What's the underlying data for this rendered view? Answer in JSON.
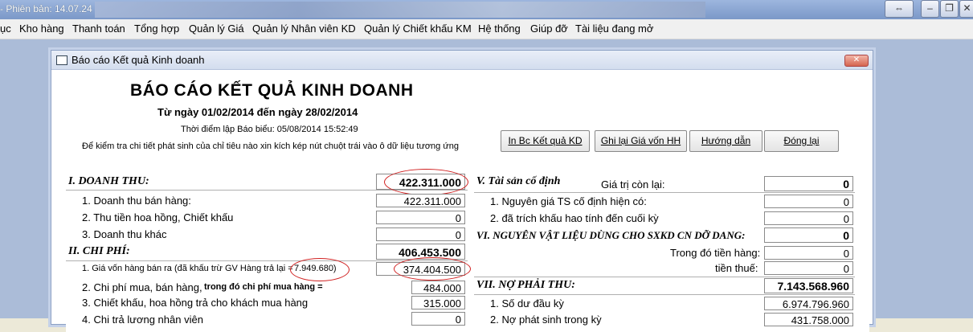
{
  "app": {
    "title_suffix": "- Phiên bản: 14.07.24",
    "ctrl_restore": "⇔",
    "ctrl_min": "–",
    "ctrl_max": "❐",
    "ctrl_close": "✕"
  },
  "menu": [
    "ục",
    "Kho hàng",
    "Thanh toán",
    "Tổng hợp",
    "Quản lý Giá",
    "Quản lý Nhân viên KD",
    "Quản lý Chiết khấu KM",
    "Hệ thống",
    "Giúp đỡ",
    "Tài liệu đang mở"
  ],
  "dialog": {
    "title": "Báo cáo Kết quả Kinh doanh",
    "close": "✕",
    "heading": "BÁO CÁO KẾT QUẢ KINH DOANH",
    "range": "Từ ngày 01/02/2014 đến ngày 28/02/2014",
    "time": "Thời điểm lập Báo biểu: 05/08/2014 15:52:49",
    "hint": "Để kiểm tra chi tiết phát sinh của chỉ tiêu nào xin kích kép nút chuột trái vào ô dữ liệu tương ứng",
    "buttons": {
      "print": "In Bc Kết quả KD",
      "save_cost": "Ghi lại Giá vốn HH",
      "guide": "Hướng dẫn",
      "close": "Đóng lại"
    }
  },
  "left": {
    "revenue": {
      "title": "I. DOANH THU:",
      "total": "422.311.000",
      "rows": [
        {
          "label": "1. Doanh thu bán hàng:",
          "value": "422.311.000"
        },
        {
          "label": "2. Thu tiền hoa hồng, Chiết khấu",
          "value": "0"
        },
        {
          "label": "3. Doanh thu khác",
          "value": "0"
        }
      ]
    },
    "expense": {
      "title": "II. CHI PHÍ:",
      "total": "406.453.500",
      "cogs_label": "1. Giá vốn hàng bán ra  (đã khấu trừ GV Hàng trả lại =",
      "cogs_return": "7.949.680)",
      "cogs_value": "374.404.500",
      "purchase_label": "2. Chi phí mua, bán hàng,",
      "purchase_note": "trong đó chi phí mua hàng =",
      "purchase_value": "484.000",
      "discount_label": "3. Chiết khấu, hoa hồng trả cho khách mua hàng",
      "discount_value": "315.000",
      "salary_label": "4. Chi trả lương nhân viên",
      "salary_value": "0"
    }
  },
  "right": {
    "fixed": {
      "title": "V. Tài sản cố định",
      "remaining_label": "Giá trị còn lại:",
      "remaining_value": "0",
      "rows": [
        {
          "label": "1. Nguyên giá TS cố định hiện có:",
          "value": "0"
        },
        {
          "label": "2. đã trích khấu hao tính đến cuối kỳ",
          "value": "0"
        }
      ]
    },
    "materials": {
      "title": "VI. NGUYÊN VẬT LIỆU DÙNG CHO SXKD CN DỠ DANG:",
      "value": "0",
      "goods_label": "Trong đó tiền hàng:",
      "goods_value": "0",
      "tax_label": "tiền thuế:",
      "tax_value": "0"
    },
    "receivable": {
      "title": "VII. NỢ PHẢI THU:",
      "total": "7.143.568.960",
      "rows": [
        {
          "label": "1. Số dư đầu kỳ",
          "value": "6.974.796.960"
        },
        {
          "label": "2. Nợ phát sinh trong kỳ",
          "value": "431.758.000"
        }
      ]
    }
  }
}
